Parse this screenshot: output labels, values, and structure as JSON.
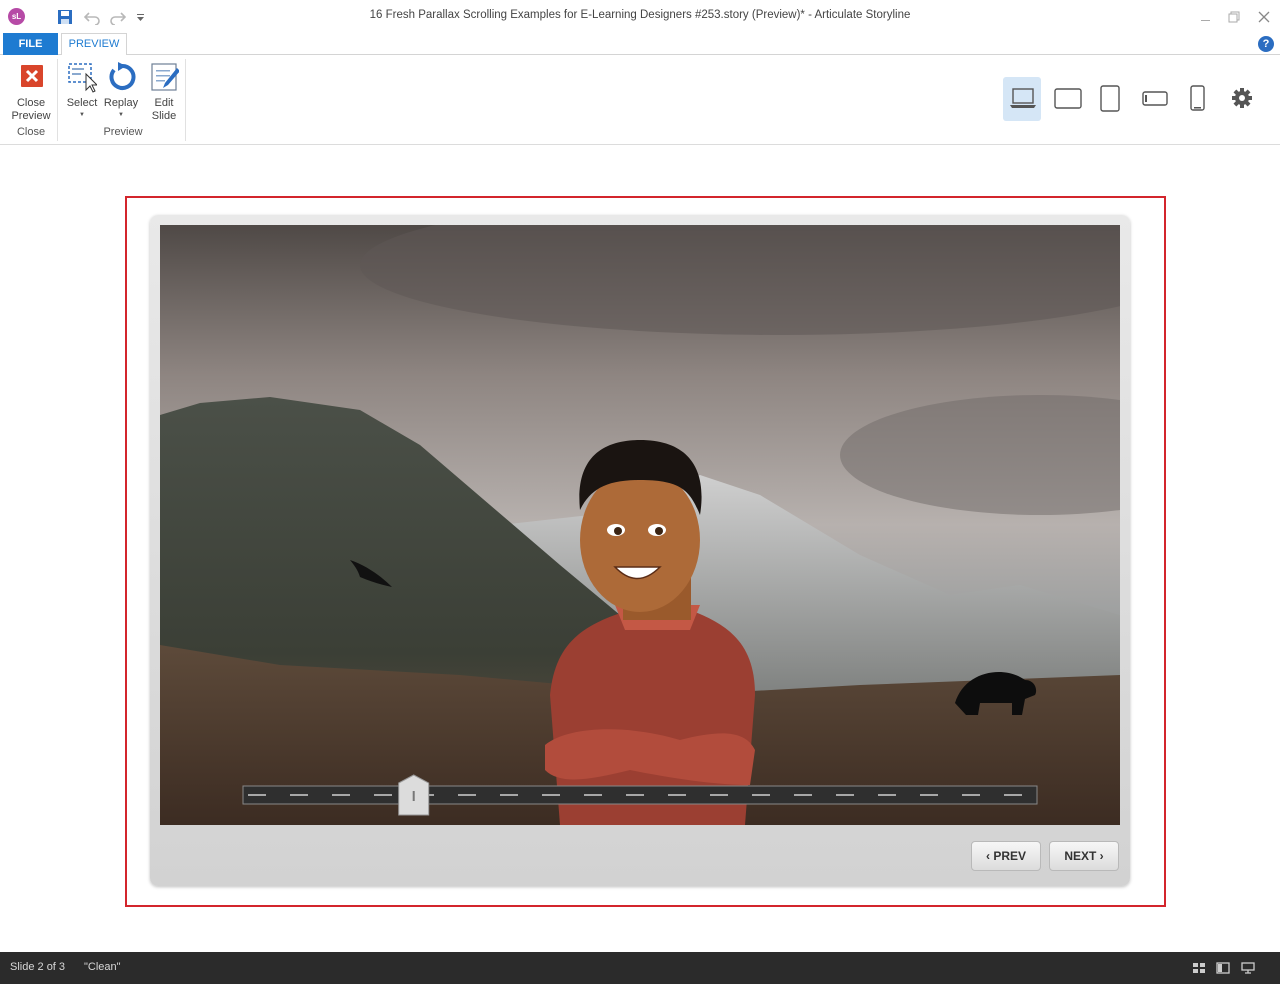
{
  "titlebar": {
    "app_badge": "sL",
    "title": "16 Fresh Parallax Scrolling Examples for E-Learning Designers #253.story (Preview)* -  Articulate Storyline",
    "qat_icons": [
      "save-icon",
      "undo-icon",
      "redo-icon",
      "customize-icon"
    ],
    "window_controls": [
      "minimize-icon",
      "restore-icon",
      "close-icon"
    ]
  },
  "tabs": {
    "file": "FILE",
    "preview": "PREVIEW",
    "help": "?"
  },
  "ribbon": {
    "close_preview": {
      "line1": "Close",
      "line2": "Preview"
    },
    "close_group_label": "Close",
    "select": "Select",
    "replay": "Replay",
    "edit_slide": {
      "line1": "Edit",
      "line2": "Slide"
    },
    "preview_group_label": "Preview",
    "devices": [
      "laptop-icon",
      "tablet-landscape-icon",
      "tablet-portrait-icon",
      "phone-landscape-icon",
      "phone-portrait-icon",
      "settings-gear-icon"
    ],
    "active_device": "laptop-icon"
  },
  "player": {
    "prev_label": "PREV",
    "next_label": "NEXT",
    "slider_position": 0.215
  },
  "statusbar": {
    "slide_info": "Slide 2 of 3",
    "theme": "\"Clean\"",
    "view_icons": [
      "slide-sorter-icon",
      "normal-view-icon",
      "preview-view-icon"
    ]
  },
  "colors": {
    "accent": "#1e7bd1",
    "stage_border": "#d3252c",
    "statusbar": "#2b2b2b"
  }
}
